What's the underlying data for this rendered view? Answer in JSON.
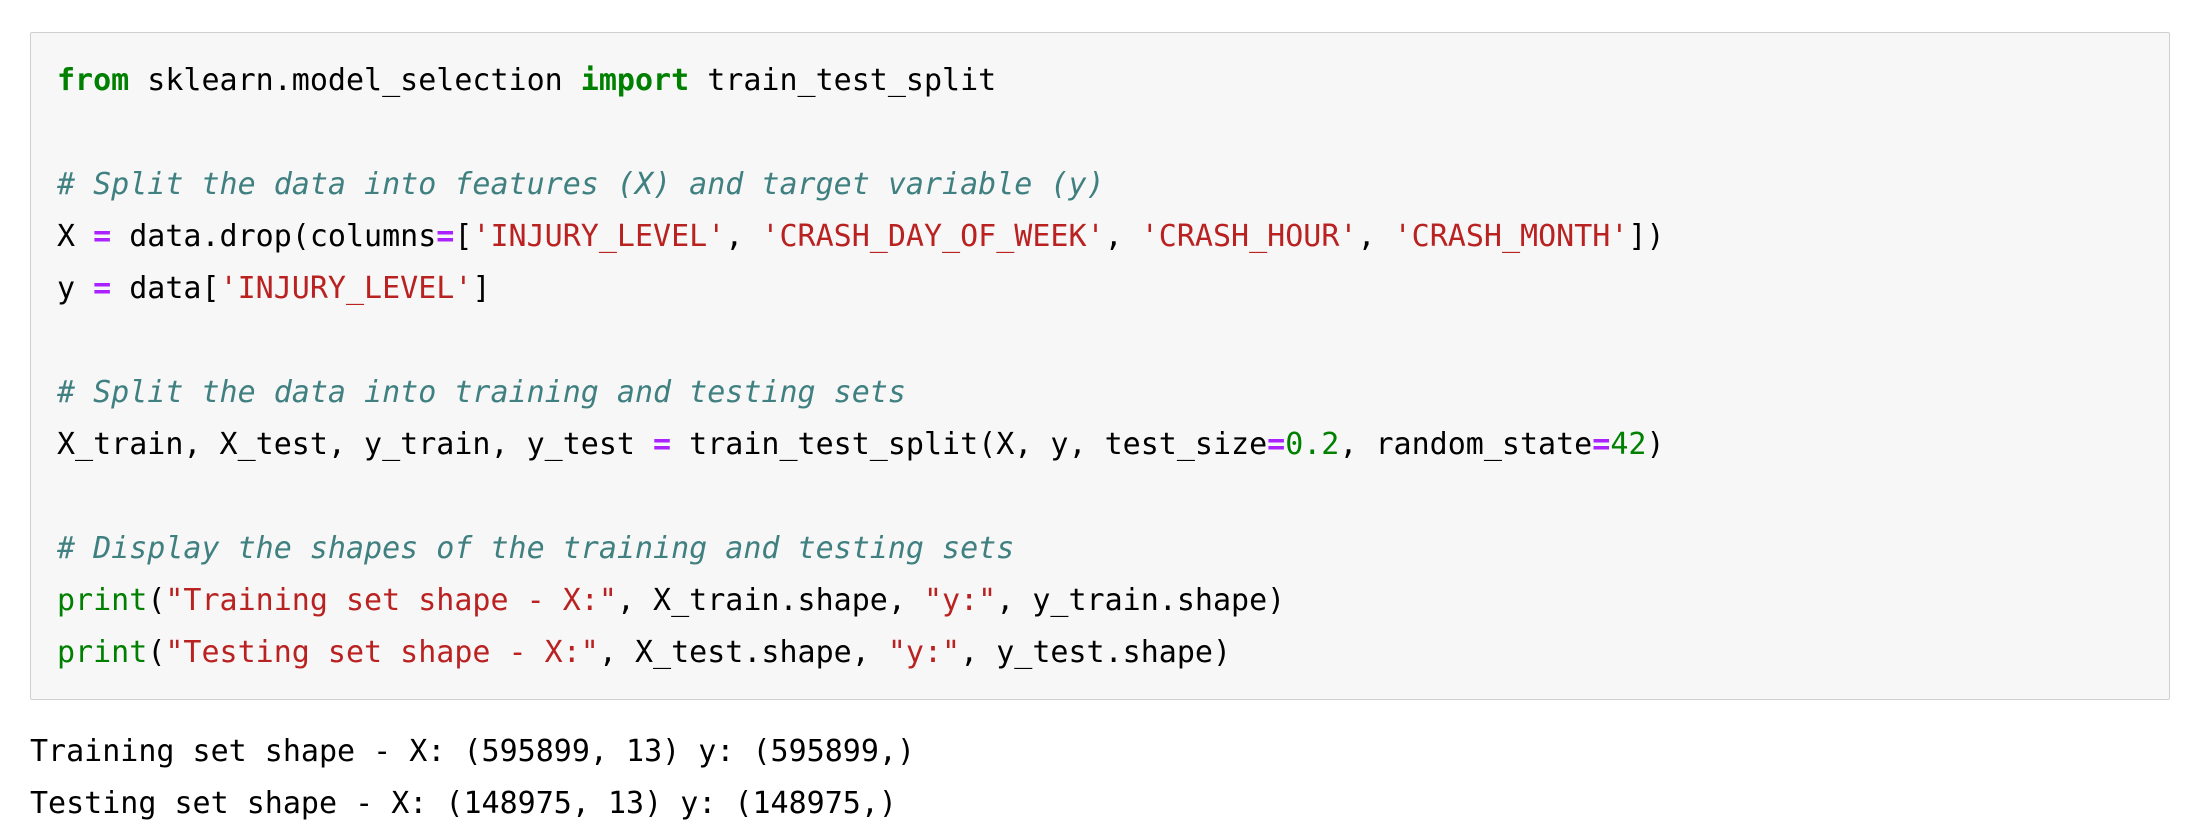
{
  "cell": {
    "background_color": "#f7f7f7",
    "border_color": "#cfcfcf",
    "lines": [
      {
        "id": "import-line",
        "tokens": [
          {
            "t": "from",
            "c": "kw"
          },
          {
            "t": " sklearn.model_selection ",
            "c": "plain"
          },
          {
            "t": "import",
            "c": "kw"
          },
          {
            "t": " train_test_split",
            "c": "plain"
          }
        ]
      },
      {
        "id": "blank-1",
        "tokens": []
      },
      {
        "id": "comment-split-features",
        "tokens": [
          {
            "t": "# Split the data into features (X) and target variable (y)",
            "c": "comment"
          }
        ]
      },
      {
        "id": "assign-X",
        "tokens": [
          {
            "t": "X ",
            "c": "plain"
          },
          {
            "t": "=",
            "c": "op"
          },
          {
            "t": " data.drop(columns",
            "c": "plain"
          },
          {
            "t": "=",
            "c": "op"
          },
          {
            "t": "[",
            "c": "plain"
          },
          {
            "t": "'INJURY_LEVEL'",
            "c": "str"
          },
          {
            "t": ", ",
            "c": "plain"
          },
          {
            "t": "'CRASH_DAY_OF_WEEK'",
            "c": "str"
          },
          {
            "t": ", ",
            "c": "plain"
          },
          {
            "t": "'CRASH_HOUR'",
            "c": "str"
          },
          {
            "t": ", ",
            "c": "plain"
          },
          {
            "t": "'CRASH_MONTH'",
            "c": "str"
          },
          {
            "t": "])",
            "c": "plain"
          }
        ]
      },
      {
        "id": "assign-y",
        "tokens": [
          {
            "t": "y ",
            "c": "plain"
          },
          {
            "t": "=",
            "c": "op"
          },
          {
            "t": " data[",
            "c": "plain"
          },
          {
            "t": "'INJURY_LEVEL'",
            "c": "str"
          },
          {
            "t": "]",
            "c": "plain"
          }
        ]
      },
      {
        "id": "blank-2",
        "tokens": []
      },
      {
        "id": "comment-split-train-test",
        "tokens": [
          {
            "t": "# Split the data into training and testing sets",
            "c": "comment"
          }
        ]
      },
      {
        "id": "train-test-split-call",
        "tokens": [
          {
            "t": "X_train, X_test, y_train, y_test ",
            "c": "plain"
          },
          {
            "t": "=",
            "c": "op"
          },
          {
            "t": " train_test_split(X, y, test_size",
            "c": "plain"
          },
          {
            "t": "=",
            "c": "op"
          },
          {
            "t": "0.2",
            "c": "num"
          },
          {
            "t": ", random_state",
            "c": "plain"
          },
          {
            "t": "=",
            "c": "op"
          },
          {
            "t": "42",
            "c": "num"
          },
          {
            "t": ")",
            "c": "plain"
          }
        ]
      },
      {
        "id": "blank-3",
        "tokens": []
      },
      {
        "id": "comment-display-shapes",
        "tokens": [
          {
            "t": "# Display the shapes of the training and testing sets",
            "c": "comment"
          }
        ]
      },
      {
        "id": "print-training-shape",
        "tokens": [
          {
            "t": "print",
            "c": "builtin"
          },
          {
            "t": "(",
            "c": "plain"
          },
          {
            "t": "\"Training set shape - X:\"",
            "c": "str"
          },
          {
            "t": ", X_train.shape, ",
            "c": "plain"
          },
          {
            "t": "\"y:\"",
            "c": "str"
          },
          {
            "t": ", y_train.shape)",
            "c": "plain"
          }
        ]
      },
      {
        "id": "print-testing-shape",
        "tokens": [
          {
            "t": "print",
            "c": "builtin"
          },
          {
            "t": "(",
            "c": "plain"
          },
          {
            "t": "\"Testing set shape - X:\"",
            "c": "str"
          },
          {
            "t": ", X_test.shape, ",
            "c": "plain"
          },
          {
            "t": "\"y:\"",
            "c": "str"
          },
          {
            "t": ", y_test.shape)",
            "c": "plain"
          }
        ]
      }
    ]
  },
  "output": {
    "lines": [
      "Training set shape - X: (595899, 13) y: (595899,)",
      "Testing set shape - X: (148975, 13) y: (148975,)"
    ]
  },
  "colors": {
    "keyword": "#008000",
    "comment": "#408080",
    "string": "#BA2121",
    "number": "#008000",
    "operator": "#AA22FF",
    "builtin": "#008000",
    "plain": "#000000"
  }
}
